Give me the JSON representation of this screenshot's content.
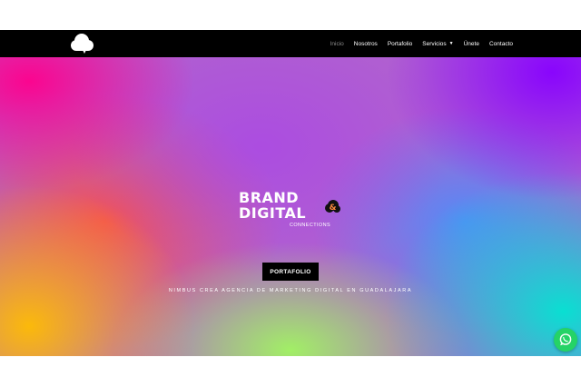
{
  "header": {
    "logo_icon": "cloud-icon",
    "nav": [
      {
        "label": "Inicio",
        "active": true
      },
      {
        "label": "Nosotros",
        "active": false
      },
      {
        "label": "Portafolio",
        "active": false
      },
      {
        "label": "Servicios",
        "active": false,
        "dropdown": true,
        "dropdown_icon": "chevron-down-icon"
      },
      {
        "label": "Únete",
        "active": false
      },
      {
        "label": "Contacto",
        "active": false
      }
    ]
  },
  "hero": {
    "brand_line1": "BRAND",
    "brand_line2": "DIGITAL",
    "brand_sub": "CONNECTIONS",
    "brand_badge_icon": "ampersand-cloud-icon",
    "cta_label": "PORTAFOLIO",
    "tagline": "NIMBUS CREA AGENCIA DE MARKETING DIGITAL EN GUADALAJARA"
  },
  "floating": {
    "whatsapp_icon": "whatsapp-icon"
  },
  "colors": {
    "navbar_bg": "#000000",
    "nav_active": "#8a8a8a",
    "cta_bg": "#000000",
    "whatsapp": "#25d366"
  }
}
